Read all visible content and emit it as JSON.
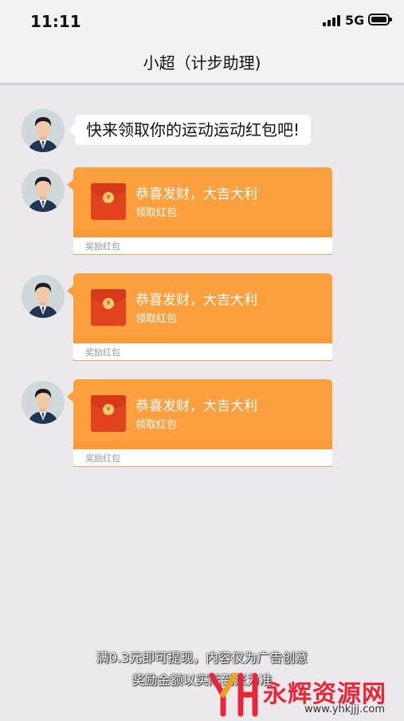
{
  "status_bar": {
    "time": "11:11",
    "network": "5G"
  },
  "header": {
    "title": "小超（计步助理)"
  },
  "chat": {
    "greeting": "快来领取你的运动运动红包吧!",
    "envelopes": [
      {
        "title": "恭喜发财，大吉大利",
        "subtitle": "领取红包",
        "footer": "奖励红包"
      },
      {
        "title": "恭喜发财，大吉大利",
        "subtitle": "领取红包",
        "footer": "奖励红包"
      },
      {
        "title": "恭喜发财，大吉大利",
        "subtitle": "领取红包",
        "footer": "奖励红包"
      }
    ]
  },
  "disclaimer": {
    "line1": "满0.3元即可提现，内容仅为广告创意",
    "line2": "奖励金额以实际到账为准"
  },
  "watermark": {
    "name": "永辉资源网",
    "url": "www.yhkjjj.com"
  },
  "colors": {
    "envelope_orange": "#fca03f",
    "envelope_red": "#e2431e",
    "background": "#ebe9ec"
  },
  "icons": {
    "signal": "signal-bars-icon",
    "battery": "battery-icon",
    "envelope": "red-envelope-icon"
  }
}
